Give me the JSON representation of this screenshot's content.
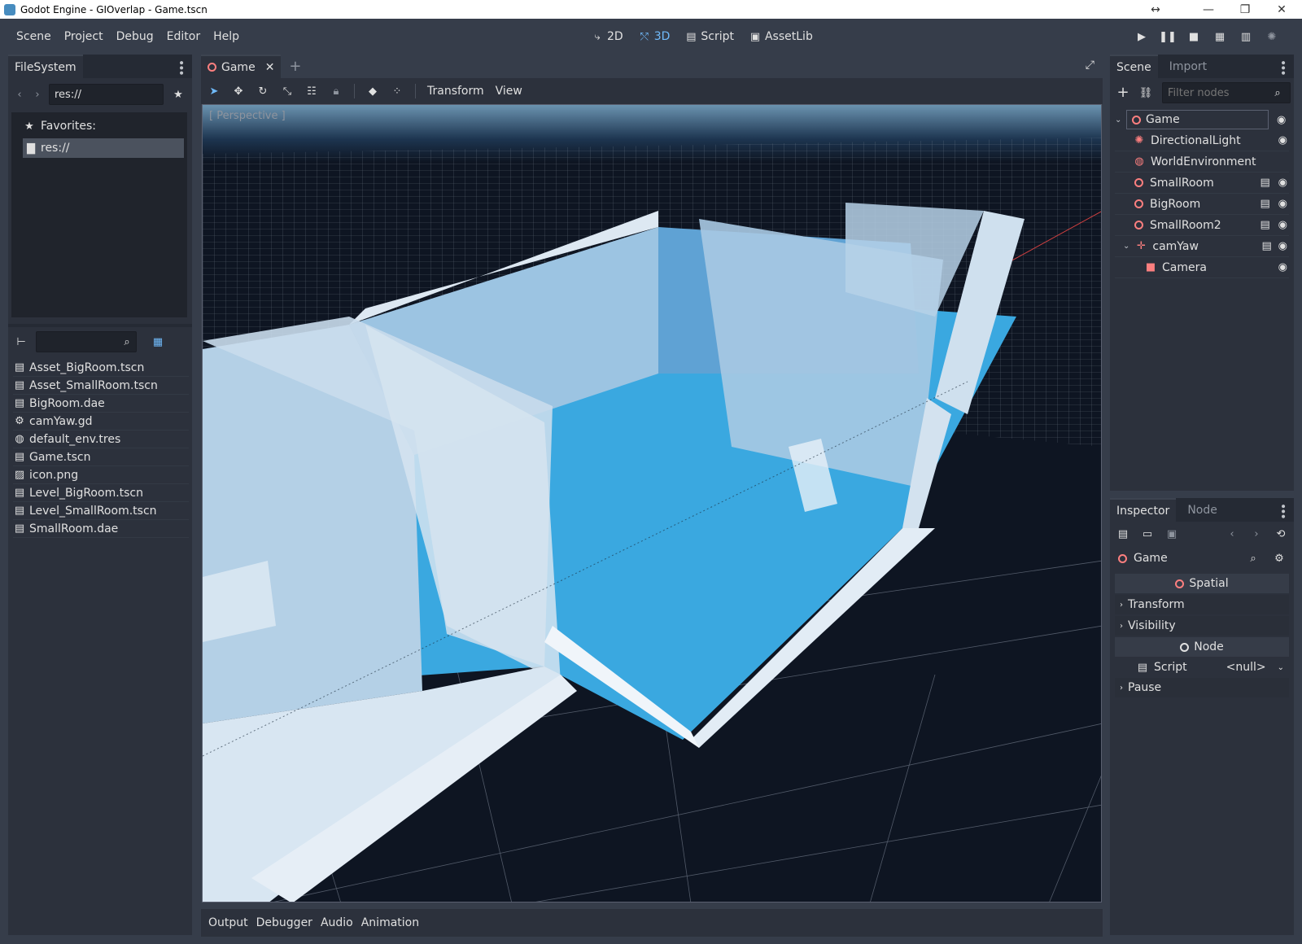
{
  "window": {
    "title": "Godot Engine - GIOverlap - Game.tscn"
  },
  "menu": {
    "items": [
      "Scene",
      "Project",
      "Debug",
      "Editor",
      "Help"
    ]
  },
  "modes": {
    "items": [
      {
        "label": "2D",
        "icon": "2d-icon"
      },
      {
        "label": "3D",
        "icon": "3d-icon"
      },
      {
        "label": "Script",
        "icon": "script-icon"
      },
      {
        "label": "AssetLib",
        "icon": "assetlib-icon"
      }
    ],
    "active": "3D"
  },
  "filesystem": {
    "tab": "FileSystem",
    "path": "res://",
    "favorites_label": "Favorites:",
    "root_label": "res://",
    "files": [
      {
        "name": "Asset_BigRoom.tscn",
        "icon": "scene-icon"
      },
      {
        "name": "Asset_SmallRoom.tscn",
        "icon": "scene-icon"
      },
      {
        "name": "BigRoom.dae",
        "icon": "scene-icon"
      },
      {
        "name": "camYaw.gd",
        "icon": "gear-icon"
      },
      {
        "name": "default_env.tres",
        "icon": "globe-icon"
      },
      {
        "name": "Game.tscn",
        "icon": "scene-icon"
      },
      {
        "name": "icon.png",
        "icon": "image-icon"
      },
      {
        "name": "Level_BigRoom.tscn",
        "icon": "scene-icon"
      },
      {
        "name": "Level_SmallRoom.tscn",
        "icon": "scene-icon"
      },
      {
        "name": "SmallRoom.dae",
        "icon": "scene-icon"
      }
    ]
  },
  "editor": {
    "scene_tab": "Game",
    "toolbar_menus": [
      "Transform",
      "View"
    ],
    "viewport_label": "[ Perspective ]"
  },
  "bottom": {
    "tabs": [
      "Output",
      "Debugger",
      "Audio",
      "Animation"
    ]
  },
  "scene": {
    "tabs": [
      "Scene",
      "Import"
    ],
    "filter_placeholder": "Filter nodes",
    "nodes": [
      {
        "name": "Game",
        "depth": 0,
        "icon": "spatial-icon",
        "instance": false,
        "visible": true
      },
      {
        "name": "DirectionalLight",
        "depth": 1,
        "icon": "light-icon",
        "instance": false,
        "visible": true
      },
      {
        "name": "WorldEnvironment",
        "depth": 1,
        "icon": "environment-icon",
        "instance": false,
        "visible": false
      },
      {
        "name": "SmallRoom",
        "depth": 1,
        "icon": "spatial-icon",
        "instance": true,
        "visible": true
      },
      {
        "name": "BigRoom",
        "depth": 1,
        "icon": "spatial-icon",
        "instance": true,
        "visible": true
      },
      {
        "name": "SmallRoom2",
        "depth": 1,
        "icon": "spatial-icon",
        "instance": true,
        "visible": true
      },
      {
        "name": "camYaw",
        "depth": 1,
        "icon": "position-icon",
        "instance": false,
        "script": true,
        "visible": true
      },
      {
        "name": "Camera",
        "depth": 2,
        "icon": "camera-icon",
        "instance": false,
        "visible": true
      }
    ]
  },
  "inspector": {
    "tabs": [
      "Inspector",
      "Node"
    ],
    "object": "Game",
    "cat_spatial": "Spatial",
    "sec_transform": "Transform",
    "sec_visibility": "Visibility",
    "cat_node": "Node",
    "script_label": "Script",
    "script_value": "<null>",
    "sec_pause": "Pause"
  },
  "colors": {
    "accent": "#70bafa",
    "node_icon": "#fc7f7f",
    "panel": "#2c313c",
    "background": "#363d4a"
  }
}
